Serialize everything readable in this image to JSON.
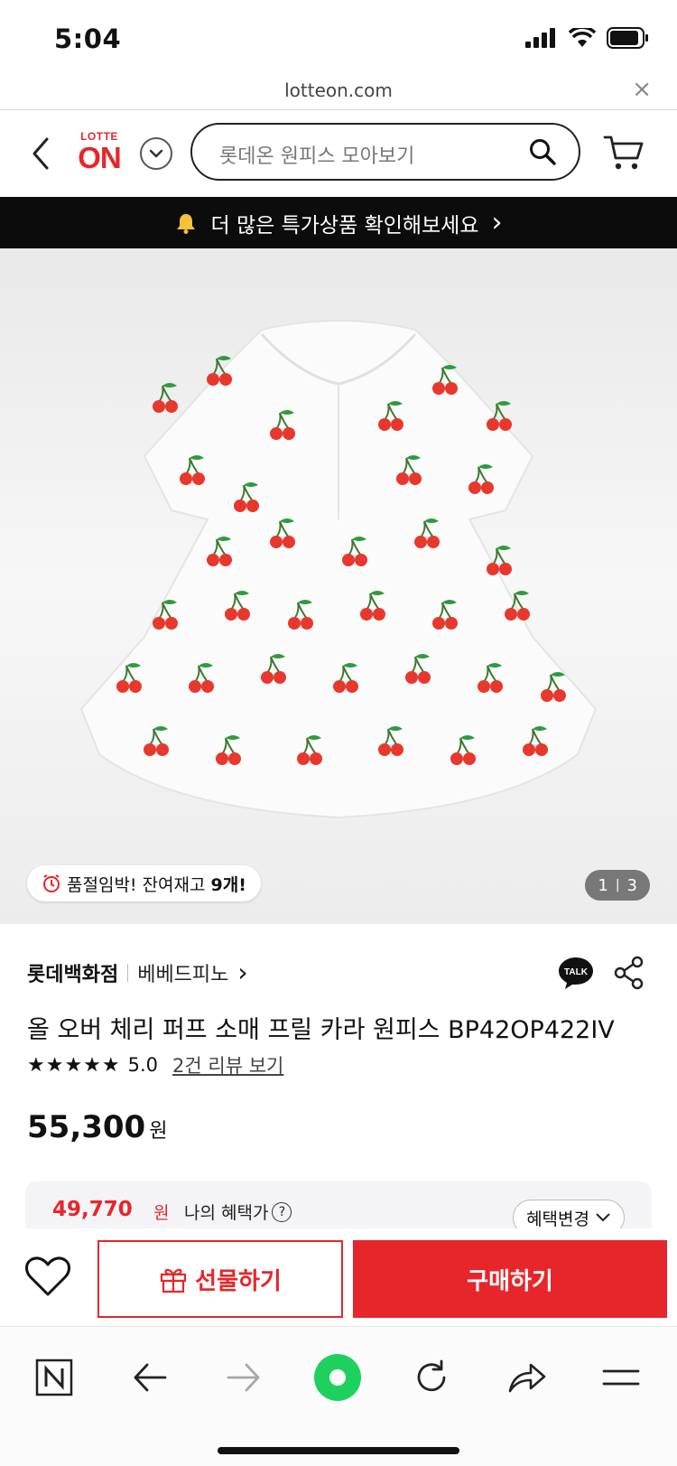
{
  "status_bar": {
    "time": "5:04"
  },
  "url_bar": {
    "url": "lotteon.com",
    "close": "×"
  },
  "header": {
    "logo_top": "LOTTE",
    "logo_main": "ON",
    "search_placeholder": "롯데온 원피스 모아보기"
  },
  "promo": {
    "text": "더 많은 특가상품 확인해보세요",
    "arrow": "›"
  },
  "product_image": {
    "stock_prefix": "품절임박! 잔여재고 ",
    "stock_count": "9개!",
    "page_current": "1",
    "page_sep": "|",
    "page_total": "3"
  },
  "product": {
    "store": "롯데백화점",
    "brand": "베베드피노",
    "brand_arrow": "›",
    "title": "올 오버 체리 퍼프 소매 프릴 카라 원피스 BP42OP422IV",
    "stars": "★★★★★",
    "rating": "5.0",
    "review_link": "2건 리뷰 보기",
    "price": "55,300",
    "price_unit": "원",
    "benefit_price": "49,770",
    "benefit_unit": "원",
    "benefit_label": "나의 혜택가",
    "benefit_help": "?",
    "benefit_change": "혜택변경"
  },
  "actions": {
    "gift": "선물하기",
    "buy": "구매하기"
  },
  "colors": {
    "brand_red": "#e7262b",
    "promo_bg": "#0c0c0c",
    "talk_yellow": "#222222",
    "toolbar_green": "#1ed15f"
  },
  "icons": [
    "back-icon",
    "chevron-down-icon",
    "search-icon",
    "cart-icon",
    "bell-icon",
    "alarm-icon",
    "talk-icon",
    "share-icon",
    "heart-icon",
    "gift-icon",
    "naver-n-icon",
    "arrow-left-icon",
    "arrow-right-icon",
    "green-dot-icon",
    "refresh-icon",
    "share-arrow-icon",
    "menu-icon"
  ]
}
